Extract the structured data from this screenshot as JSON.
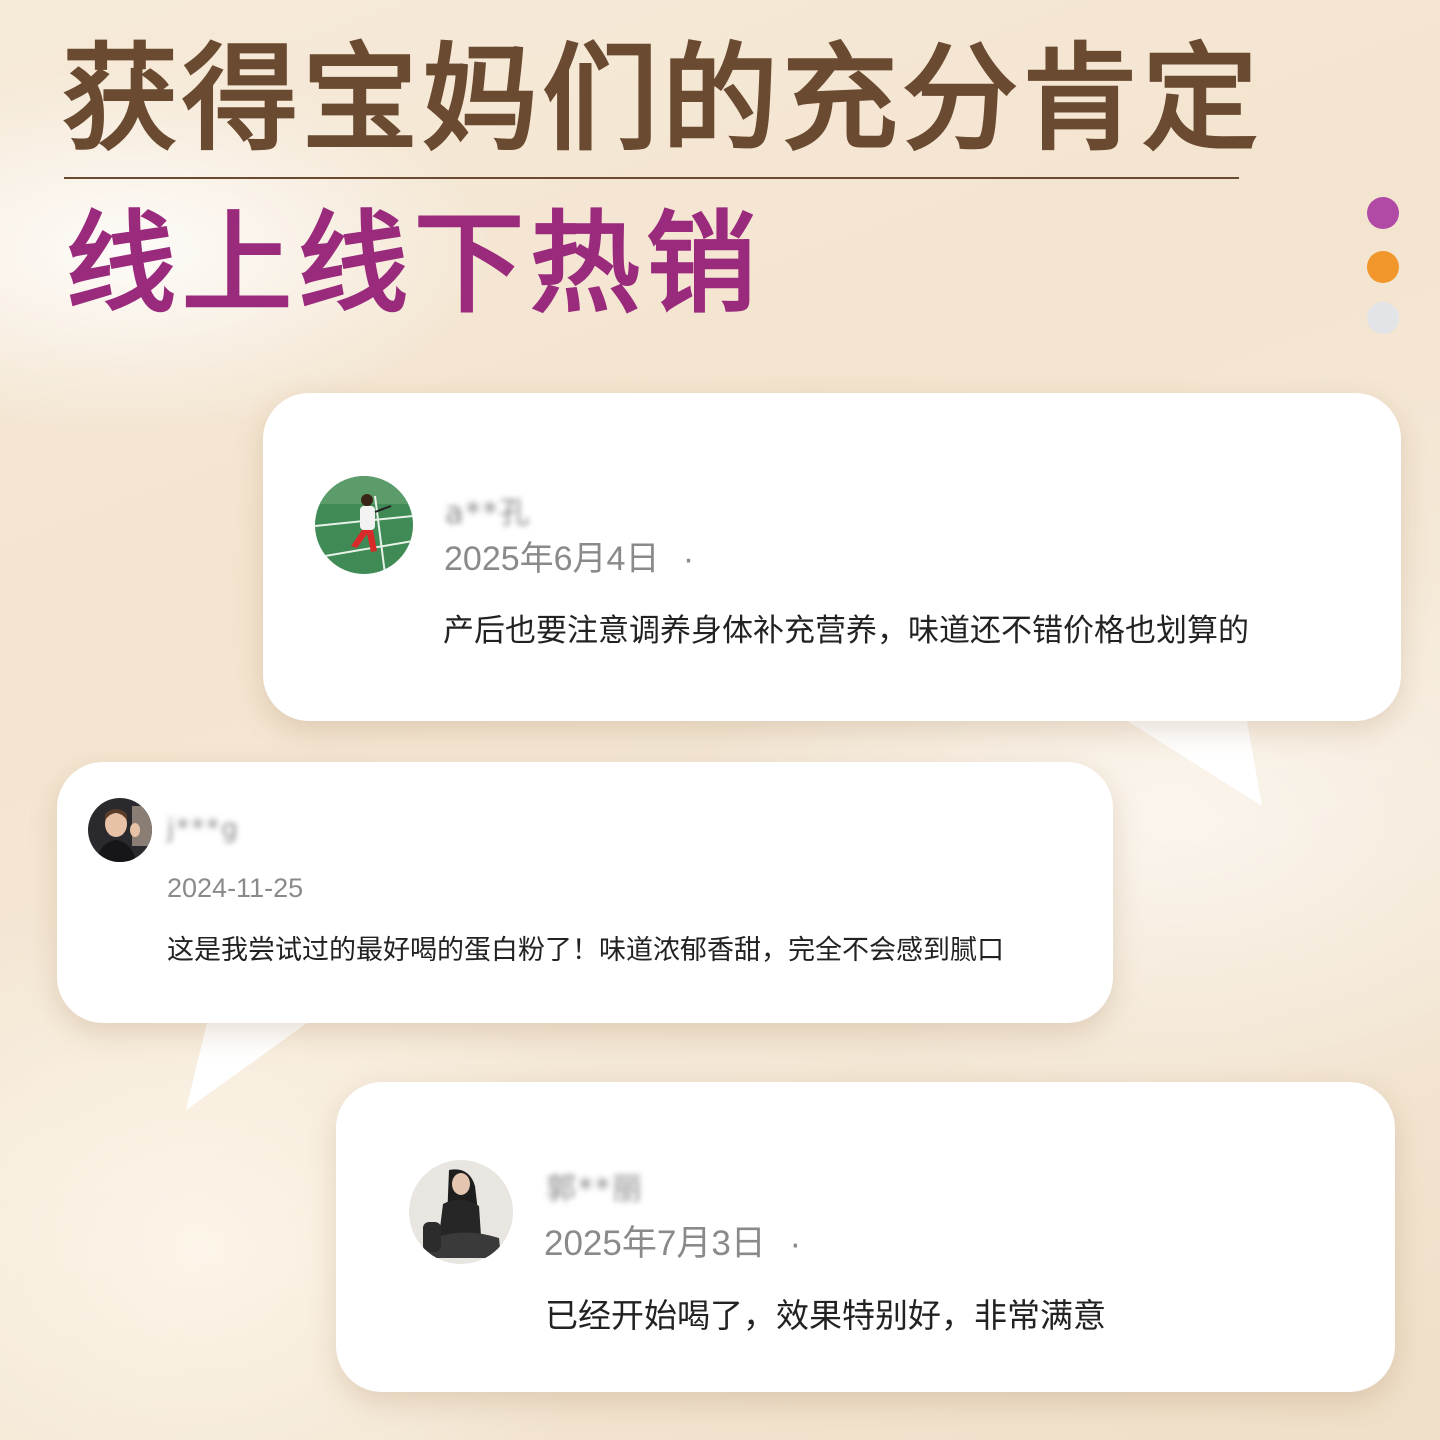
{
  "title": "获得宝妈们的充分肯定",
  "subtitle": "线上线下热销",
  "indicator_colors": [
    "#b04aa4",
    "#f0962a",
    "#e2e4e8"
  ],
  "reviews": [
    {
      "username": "a**孔",
      "date": "2025年6月4日",
      "separator": "·",
      "text": "产后也要注意调养身体补充营养，味道还不错价格也划算的",
      "avatar_icon": "badminton-player-avatar"
    },
    {
      "username": "j***g",
      "date": "2024-11-25",
      "text": "这是我尝试过的最好喝的蛋白粉了！味道浓郁香甜，完全不会感到腻口",
      "avatar_icon": "smiling-man-avatar"
    },
    {
      "username": "郭**丽",
      "date": "2025年7月3日",
      "separator": "·",
      "text": "已经开始喝了，效果特别好，非常满意",
      "avatar_icon": "seated-woman-avatar"
    }
  ]
}
